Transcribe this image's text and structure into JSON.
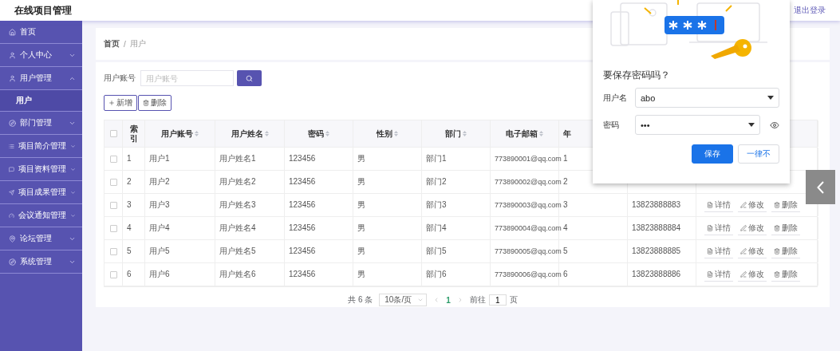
{
  "header": {
    "title": "在线项目管理",
    "logout": "退出登录"
  },
  "sidebar": {
    "items": [
      {
        "label": "首页",
        "kind": "link"
      },
      {
        "label": "个人中心",
        "kind": "group",
        "expanded": false
      },
      {
        "label": "用户管理",
        "kind": "group",
        "expanded": true,
        "children": [
          {
            "label": "用户",
            "selected": true
          }
        ]
      },
      {
        "label": "部门管理",
        "kind": "group",
        "expanded": false
      },
      {
        "label": "项目简介管理",
        "kind": "group",
        "expanded": false
      },
      {
        "label": "项目资料管理",
        "kind": "group",
        "expanded": false
      },
      {
        "label": "项目成果管理",
        "kind": "group",
        "expanded": false
      },
      {
        "label": "会议通知管理",
        "kind": "group",
        "expanded": false
      },
      {
        "label": "论坛管理",
        "kind": "group",
        "expanded": false
      },
      {
        "label": "系统管理",
        "kind": "group",
        "expanded": false
      }
    ]
  },
  "breadcrumb": {
    "items": [
      "首页",
      "用户"
    ],
    "separator": "/"
  },
  "search": {
    "label": "用户账号",
    "placeholder": "用户账号"
  },
  "toolbar": [
    {
      "label": "新增",
      "kind": "add"
    },
    {
      "label": "删除",
      "kind": "delete"
    }
  ],
  "table": {
    "select_all_checked": false,
    "columns": [
      {
        "label": "索引"
      },
      {
        "label": "用户账号",
        "sortable": true
      },
      {
        "label": "用户姓名",
        "sortable": true
      },
      {
        "label": "密码",
        "sortable": true
      },
      {
        "label": "性别",
        "sortable": true
      },
      {
        "label": "部门",
        "sortable": true
      },
      {
        "label": "电子邮箱",
        "sortable": true
      },
      {
        "label": "年"
      }
    ],
    "rows": [
      {
        "checked": false,
        "index": "1",
        "account": "用户1",
        "name": "用户姓名1",
        "password": "123456",
        "gender": "男",
        "department": "部门1",
        "email": "773890001@qq.com",
        "age": "1"
      },
      {
        "checked": false,
        "index": "2",
        "account": "用户2",
        "name": "用户姓名2",
        "password": "123456",
        "gender": "男",
        "department": "部门2",
        "email": "773890002@qq.com",
        "age": "2"
      },
      {
        "checked": false,
        "index": "3",
        "account": "用户3",
        "name": "用户姓名3",
        "password": "123456",
        "gender": "男",
        "department": "部门3",
        "email": "773890003@qq.com",
        "age": "3",
        "phone": "13823888883",
        "actions": [
          {
            "label": "详情",
            "kind": "detail"
          },
          {
            "label": "修改",
            "kind": "edit"
          },
          {
            "label": "删除",
            "kind": "delete"
          }
        ]
      },
      {
        "checked": false,
        "index": "4",
        "account": "用户4",
        "name": "用户姓名4",
        "password": "123456",
        "gender": "男",
        "department": "部门4",
        "email": "773890004@qq.com",
        "age": "4",
        "phone": "13823888884",
        "actions": [
          {
            "label": "详情",
            "kind": "detail"
          },
          {
            "label": "修改",
            "kind": "edit"
          },
          {
            "label": "删除",
            "kind": "delete"
          }
        ]
      },
      {
        "checked": false,
        "index": "5",
        "account": "用户5",
        "name": "用户姓名5",
        "password": "123456",
        "gender": "男",
        "department": "部门5",
        "email": "773890005@qq.com",
        "age": "5",
        "phone": "13823888885",
        "actions": [
          {
            "label": "详情",
            "kind": "detail"
          },
          {
            "label": "修改",
            "kind": "edit"
          },
          {
            "label": "删除",
            "kind": "delete"
          }
        ]
      },
      {
        "checked": false,
        "index": "6",
        "account": "用户6",
        "name": "用户姓名6",
        "password": "123456",
        "gender": "男",
        "department": "部门6",
        "email": "773890006@qq.com",
        "age": "6",
        "phone": "13823888886",
        "actions": [
          {
            "label": "详情",
            "kind": "detail"
          },
          {
            "label": "修改",
            "kind": "edit"
          },
          {
            "label": "删除",
            "kind": "delete"
          }
        ]
      }
    ]
  },
  "pagination": {
    "total": "共 6 条",
    "page_size": "10条/页",
    "pages": [
      {
        "label": "1",
        "selected": true
      }
    ],
    "goto_label": "前往",
    "goto_value": "1",
    "goto_suffix": "页"
  },
  "save_password_popup": {
    "title": "要保存密码吗？",
    "username_label": "用户名",
    "username": "abo",
    "password_label": "密码",
    "password": "•••",
    "save": "保存",
    "never": "一律不"
  }
}
